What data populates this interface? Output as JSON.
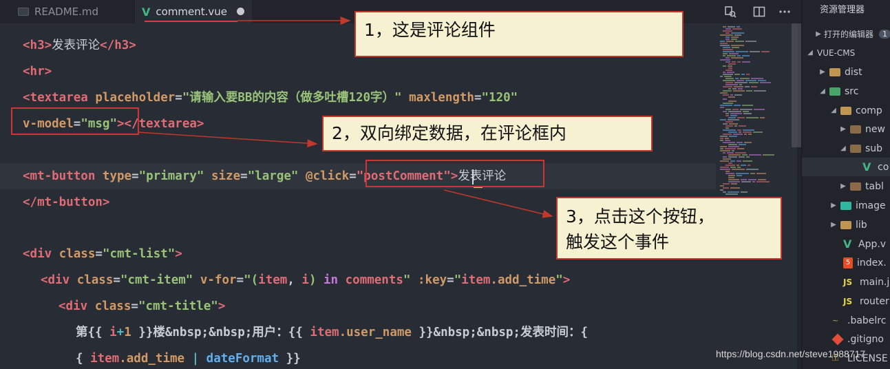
{
  "tabs": {
    "readme": "README.md",
    "comment": "comment.vue"
  },
  "explorer": {
    "title": "资源管理器",
    "open_editors": "打开的编辑器",
    "open_editors_badge": "1",
    "project": "VUE-CMS",
    "items": [
      {
        "label": "dist"
      },
      {
        "label": "src"
      },
      {
        "label": "comp"
      },
      {
        "label": "new"
      },
      {
        "label": "sub"
      },
      {
        "label": "co"
      },
      {
        "label": "tabl"
      },
      {
        "label": "image"
      },
      {
        "label": "lib"
      },
      {
        "label": "App.v"
      },
      {
        "label": "index."
      },
      {
        "label": "main.j"
      },
      {
        "label": "router"
      },
      {
        "label": ".babelrc"
      },
      {
        "label": ".gitigno"
      },
      {
        "label": "LICENSE"
      }
    ]
  },
  "code": {
    "l1_open": "<h3>",
    "l1_text": "发表评论",
    "l1_close": "</h3>",
    "l2": "<hr>",
    "l3_tag": "<textarea",
    "l3_attr1": "placeholder",
    "l3_val1": "\"请输入要BB的内容（做多吐槽120字）\"",
    "l3_attr2": "maxlength",
    "l3_val2": "\"120\"",
    "l4_attr": "v-model",
    "l4_val": "\"msg\"",
    "l4_close": "></textarea>",
    "l6_tag": "<mt-button",
    "l6_attr1": "type",
    "l6_val1": "\"primary\"",
    "l6_attr2": "size",
    "l6_val2": "\"large\"",
    "l6_attr3": "@click",
    "l6_val3": "\"postComment\"",
    "l6_text": "发表评论",
    "l7": "</mt-button>",
    "l9_tag": "<div",
    "l9_attr": "class",
    "l9_val": "\"cmt-list\"",
    "l10_tag": "<div",
    "l10_attr1": "class",
    "l10_val1": "\"cmt-item\"",
    "l10_attr2": "v-for",
    "l10_q1": "\"(",
    "l10_item": "item",
    "l10_comma": ", ",
    "l10_i": "i",
    "l10_q2": ") ",
    "l10_in": "in",
    "l10_comments": " comments",
    "l10_q3": "\"",
    "l10_attr3": ":key",
    "l10_val3a": "\"",
    "l10_val3b": "item",
    "l10_val3c": ".add_time",
    "l10_val3d": "\"",
    "l11_tag": "<div",
    "l11_attr": "class",
    "l11_val": "\"cmt-title\"",
    "l12_a": "第{{ ",
    "l12_b": "i",
    "l12_c": "+",
    "l12_d": "1",
    "l12_e": " }}楼&nbsp;&nbsp;用户：{{ ",
    "l12_f": "item",
    "l12_g": ".user_name",
    "l12_h": " }}&nbsp;&nbsp;发表时间：{",
    "l13_a": "{ ",
    "l13_b": "item",
    "l13_c": ".add_time",
    "l13_d": " | ",
    "l13_e": "dateFormat",
    "l13_f": " }}"
  },
  "annotations": {
    "note1": "1，这是评论组件",
    "note2": "2，双向绑定数据，在评论框内",
    "note3": "3，点击这个按钮，\n触发这个事件"
  },
  "watermark": "https://blog.csdn.net/steve1988717",
  "colors": {
    "editor_bg": "#282c34",
    "note_bg": "#f6f1d0",
    "note_border": "#c0392b"
  }
}
